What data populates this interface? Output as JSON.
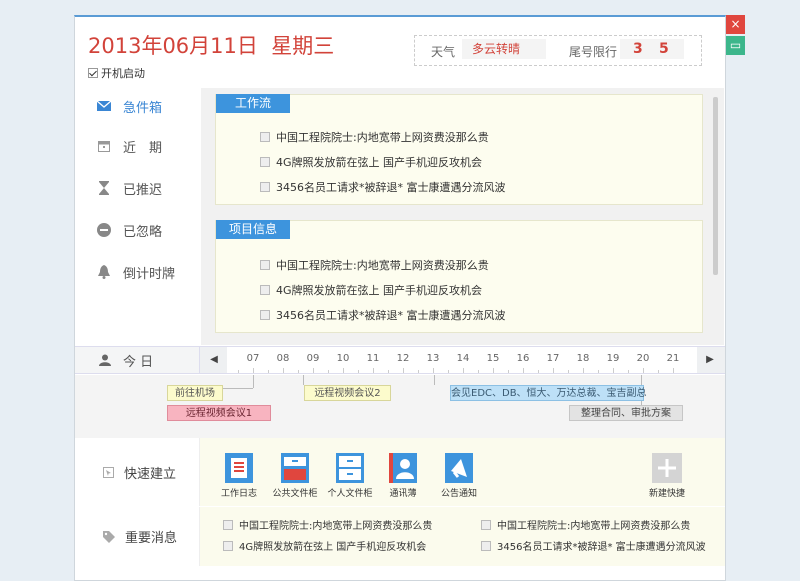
{
  "window": {
    "close_label": "×",
    "min_label": "▭"
  },
  "header": {
    "date": "2013年06月11日",
    "weekday": "星期三",
    "autostart_label": "开机启动",
    "weather_label": "天气",
    "weather_value": "多云转晴",
    "plate_label": "尾号限行",
    "plate_values": [
      "3",
      "5"
    ]
  },
  "sidebar": {
    "items": [
      {
        "label": "急件箱",
        "icon": "mail-icon",
        "active": true
      },
      {
        "label": "近　期",
        "icon": "calendar-icon",
        "active": false
      },
      {
        "label": "已推迟",
        "icon": "hourglass-icon",
        "active": false
      },
      {
        "label": "已忽略",
        "icon": "minus-circle-icon",
        "active": false
      },
      {
        "label": "倒计时牌",
        "icon": "bell-icon",
        "active": false
      }
    ]
  },
  "sections": [
    {
      "title": "工作流",
      "items": [
        "中国工程院院士:内地宽带上网资费没那么贵",
        "4G牌照发放箭在弦上 国产手机迎反攻机会",
        "3456名员工请求*被辞退* 富士康遭遇分流风波"
      ]
    },
    {
      "title": "项目信息",
      "items": [
        "中国工程院院士:内地宽带上网资费没那么贵",
        "4G牌照发放箭在弦上 国产手机迎反攻机会",
        "3456名员工请求*被辞退* 富士康遭遇分流风波"
      ]
    }
  ],
  "timeline": {
    "today_label": "今 日",
    "prev": "◀",
    "next": "▶",
    "hours": [
      "07",
      "08",
      "09",
      "10",
      "11",
      "12",
      "13",
      "14",
      "15",
      "16",
      "17",
      "18",
      "19",
      "20",
      "21"
    ]
  },
  "events": [
    {
      "label": "前往机场"
    },
    {
      "label": "远程视频会议1"
    },
    {
      "label": "远程视频会议2"
    },
    {
      "label": "会见EDC、DB、恒大、万达总裁、宝吉副总"
    },
    {
      "label": "整理合同、审批方案"
    }
  ],
  "quick": {
    "label": "快速建立",
    "items": [
      {
        "label": "工作日志",
        "icon": "worklog-icon"
      },
      {
        "label": "公共文件柜",
        "icon": "public-cabinet-icon"
      },
      {
        "label": "个人文件柜",
        "icon": "personal-cabinet-icon"
      },
      {
        "label": "通讯薄",
        "icon": "contacts-icon"
      },
      {
        "label": "公告通知",
        "icon": "announcement-icon"
      },
      {
        "label": "新建快捷",
        "icon": "add-icon"
      }
    ]
  },
  "messages": {
    "label": "重要消息",
    "items": [
      "中国工程院院士:内地宽带上网资费没那么贵",
      "中国工程院院士:内地宽带上网资费没那么贵",
      "4G牌照发放箭在弦上 国产手机迎反攻机会",
      "3456名员工请求*被辞退* 富士康遭遇分流风波"
    ]
  },
  "colors": {
    "accent": "#3d94dd",
    "date_red": "#d2433a",
    "close": "#e0463e",
    "minimize": "#3cb68b"
  }
}
